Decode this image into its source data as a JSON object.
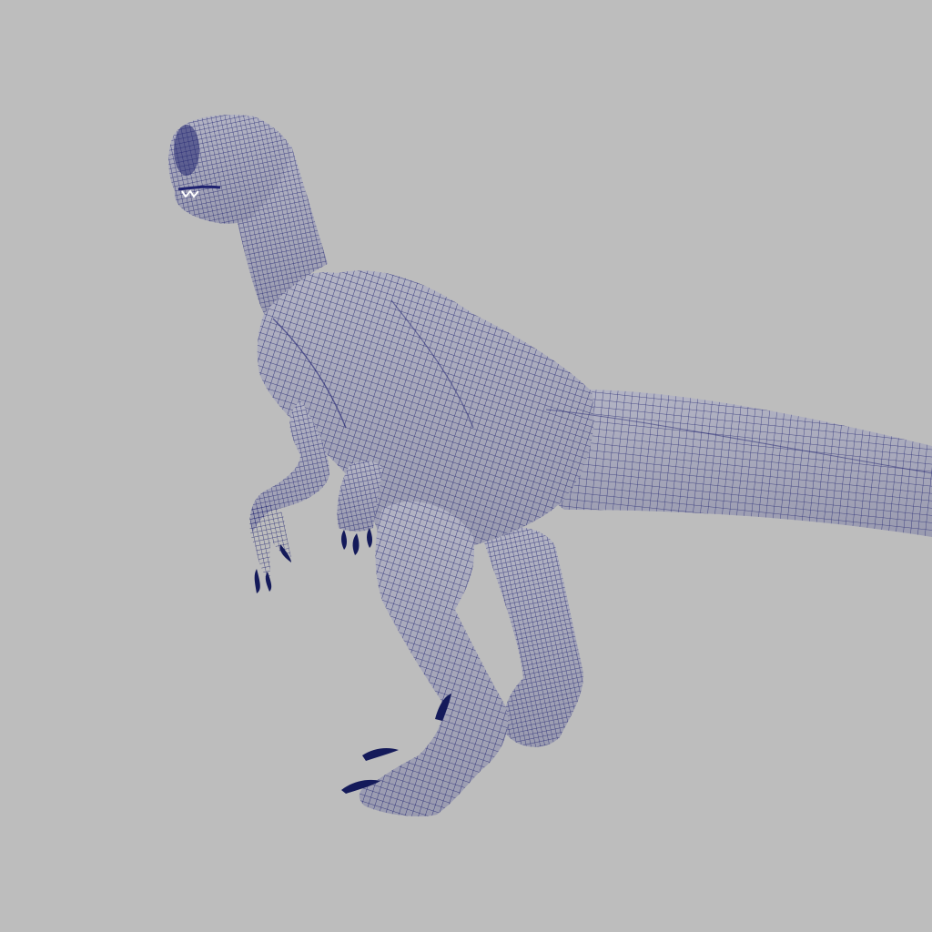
{
  "viewport": {
    "background_color": "#bdbdbd",
    "mesh_fill_color": "#a7a8b8",
    "mesh_shade_color": "#8d8ea6",
    "wire_color": "#1f2270",
    "claw_color": "#141a5a",
    "display_mode": "wireframe-on-shaded",
    "subject_icon": "raptor-model-icon"
  }
}
